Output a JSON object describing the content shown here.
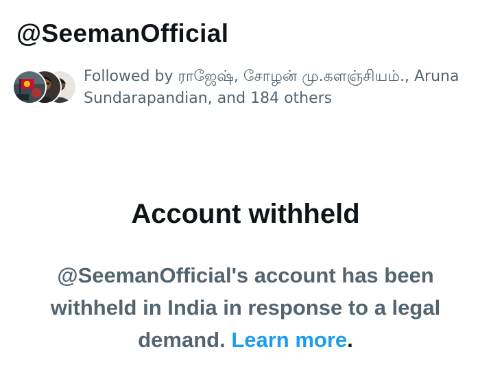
{
  "profile": {
    "handle": "@SeemanOfficial"
  },
  "followers": {
    "text": "Followed by ராஜேஷ், சோழன் மு.களஞ்சியம்., Aruna Sundarapandian, and 184 others",
    "avatars": [
      {
        "icon": "follower-avatar-flag-icon"
      },
      {
        "icon": "follower-avatar-person-icon"
      },
      {
        "icon": "follower-avatar-person-icon"
      }
    ]
  },
  "notice": {
    "title": "Account withheld",
    "message": "@SeemanOfficial's account has been withheld in India in response to a legal demand. ",
    "link_label": "Learn more",
    "trailing": "."
  },
  "colors": {
    "primary_text": "#0f1419",
    "secondary_text": "#536471",
    "link": "#1d9bf0",
    "background": "#ffffff"
  }
}
